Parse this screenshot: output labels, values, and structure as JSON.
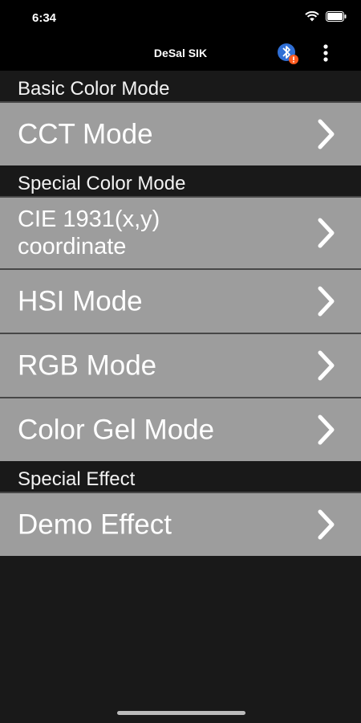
{
  "status": {
    "time": "6:34"
  },
  "app": {
    "title": "DeSal SIK"
  },
  "colors": {
    "item_bg": "#9d9d9d",
    "page_bg": "#191919",
    "bar_bg": "#000000",
    "badge": "#ff5a1f"
  },
  "sections": [
    {
      "title": "Basic Color Mode",
      "items": [
        {
          "label": "CCT Mode"
        }
      ]
    },
    {
      "title": "Special Color Mode",
      "items": [
        {
          "label_line1": "CIE 1931(x,y)",
          "label_line2": "coordinate"
        },
        {
          "label": "HSI Mode"
        },
        {
          "label": "RGB Mode"
        },
        {
          "label": "Color Gel Mode"
        }
      ]
    },
    {
      "title": "Special Effect",
      "items": [
        {
          "label": "Demo Effect"
        }
      ]
    }
  ],
  "icons": {
    "bluetooth": "bluetooth-icon",
    "more": "more-vertical-icon",
    "chevron": "chevron-right-icon"
  }
}
